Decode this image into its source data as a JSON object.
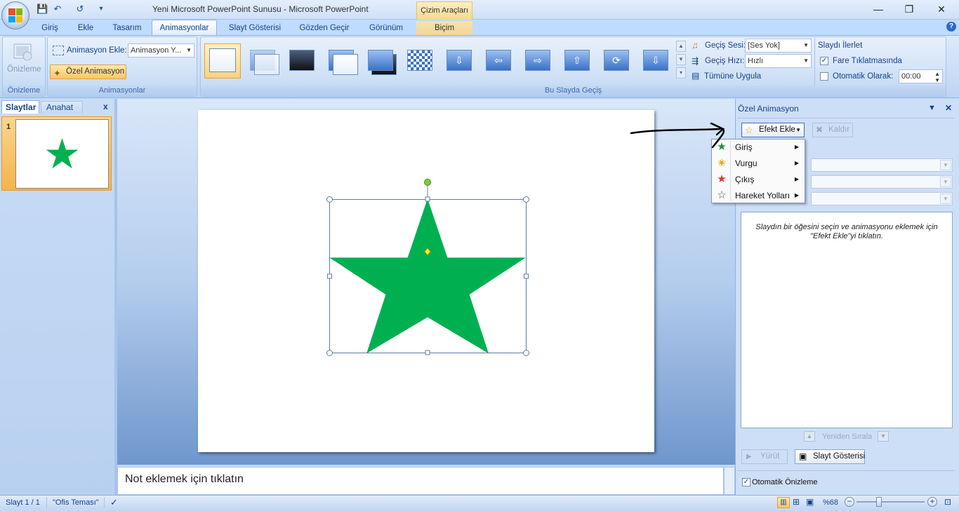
{
  "window": {
    "title": "Yeni Microsoft PowerPoint Sunusu - Microsoft PowerPoint",
    "context_tab_group": "Çizim Araçları",
    "controls": {
      "minimize": "—",
      "restore": "❐",
      "close": "✕"
    }
  },
  "quick_access": {
    "save": "💾",
    "undo": "↶",
    "redo": "↺",
    "customize": "▾"
  },
  "tabs": [
    {
      "label": "Giriş"
    },
    {
      "label": "Ekle"
    },
    {
      "label": "Tasarım"
    },
    {
      "label": "Animasyonlar",
      "active": true
    },
    {
      "label": "Slayt Gösterisi"
    },
    {
      "label": "Gözden Geçir"
    },
    {
      "label": "Görünüm"
    },
    {
      "label": "Biçim"
    }
  ],
  "help": "?",
  "ribbon": {
    "preview_group": {
      "button_label": "Önizleme",
      "group_label": "Önizleme"
    },
    "animations_group": {
      "anim_label": "Animasyon Ekle:",
      "anim_value": "Animasyon Y...",
      "custom_button": "Özel Animasyon",
      "group_label": "Animasyonlar"
    },
    "transitions_group": {
      "group_label": "Bu Slayda Geçiş",
      "sound_label": "Geçiş Sesi:",
      "sound_value": "[Ses Yok]",
      "speed_label": "Geçiş Hızı:",
      "speed_value": "Hızlı",
      "apply_all": "Tümüne Uygula"
    },
    "advance_group": {
      "title": "Slaydı İlerlet",
      "on_click_label": "Fare Tıklatmasında",
      "on_click_checked": true,
      "auto_label": "Otomatik Olarak:",
      "auto_checked": false,
      "auto_time": "00:00"
    }
  },
  "left_pane": {
    "tab_slides": "Slaytlar",
    "tab_outline": "Anahat",
    "close": "x",
    "slide_number": "1"
  },
  "notes": {
    "placeholder": "Not eklemek için tıklatın"
  },
  "task_pane": {
    "title": "Özel Animasyon",
    "add_effect": "Efekt Ekle",
    "remove": "Kaldır",
    "hint": "Slaydın bir öğesini seçin ve animasyonu eklemek için \"Efekt Ekle\"yi tıklatın.",
    "reorder": "Yeniden Sırala",
    "play": "Yürüt",
    "slideshow": "Slayt Gösterisi",
    "auto_preview": "Otomatik Önizleme",
    "auto_preview_checked": true
  },
  "effect_menu": [
    {
      "label": "Giriş",
      "icon": "entrance-star-icon",
      "color": "#1e8f3e"
    },
    {
      "label": "Vurgu",
      "icon": "emphasis-star-icon",
      "color": "#e0a800"
    },
    {
      "label": "Çıkış",
      "icon": "exit-star-icon",
      "color": "#d9372b"
    },
    {
      "label": "Hareket Yolları",
      "icon": "motion-path-star-icon",
      "color": "#555555"
    }
  ],
  "slide": {
    "shape": "star",
    "fill": "#00b050"
  },
  "status_bar": {
    "slide_info": "Slayt 1 / 1",
    "theme": "\"Ofis Teması\"",
    "zoom": "%68"
  },
  "colors": {
    "ribbon_bg": "#dce9fa",
    "accent_selected": "#f8c66a",
    "star_green": "#00b050"
  }
}
